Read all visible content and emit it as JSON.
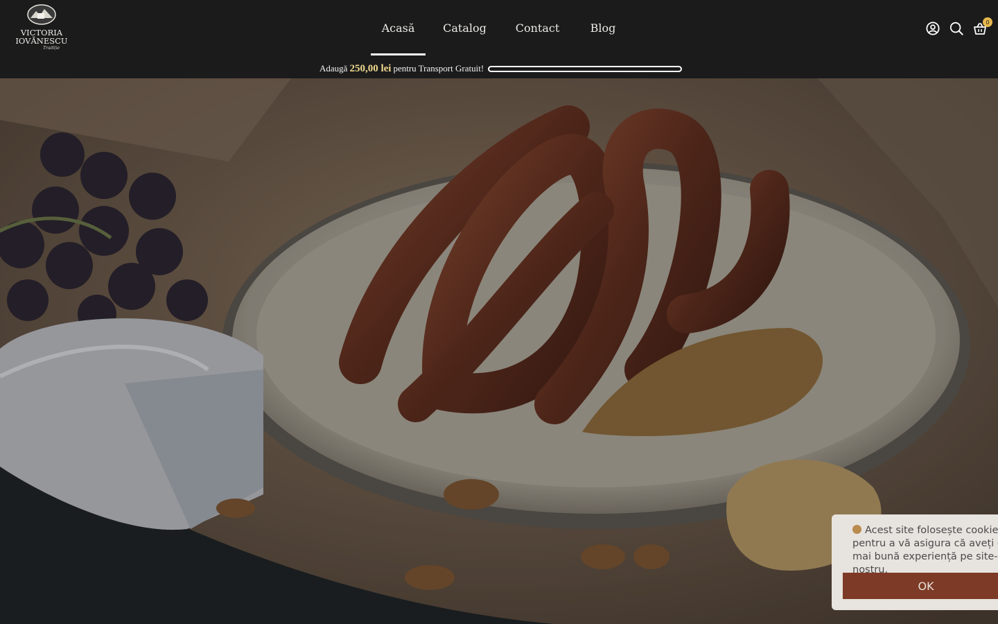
{
  "brand": {
    "name_line1": "VICTORIA",
    "name_line2": "IOVĂNESCU",
    "tagline": "Tradiție"
  },
  "nav": {
    "items": [
      {
        "label": "Acasă",
        "active": true
      },
      {
        "label": "Catalog",
        "active": false
      },
      {
        "label": "Contact",
        "active": false
      },
      {
        "label": "Blog",
        "active": false
      }
    ]
  },
  "header_icons": {
    "account": "user-circle-icon",
    "search": "search-icon",
    "cart": "basket-icon",
    "cart_count": "0"
  },
  "shipping_bar": {
    "prefix": "Adaugă",
    "amount": "250,00 lei",
    "suffix": "pentru Transport Gratuit!",
    "progress": 0
  },
  "cookie_banner": {
    "text": "Acest site folosește cookies pentru a vă asigura că aveți cea mai bună experiență pe site-ul nostru.",
    "ok_label": "OK"
  },
  "colors": {
    "header_bg": "#1b1b1c",
    "accent_gold": "#f0d98c",
    "cookie_button": "#7d3a26"
  }
}
